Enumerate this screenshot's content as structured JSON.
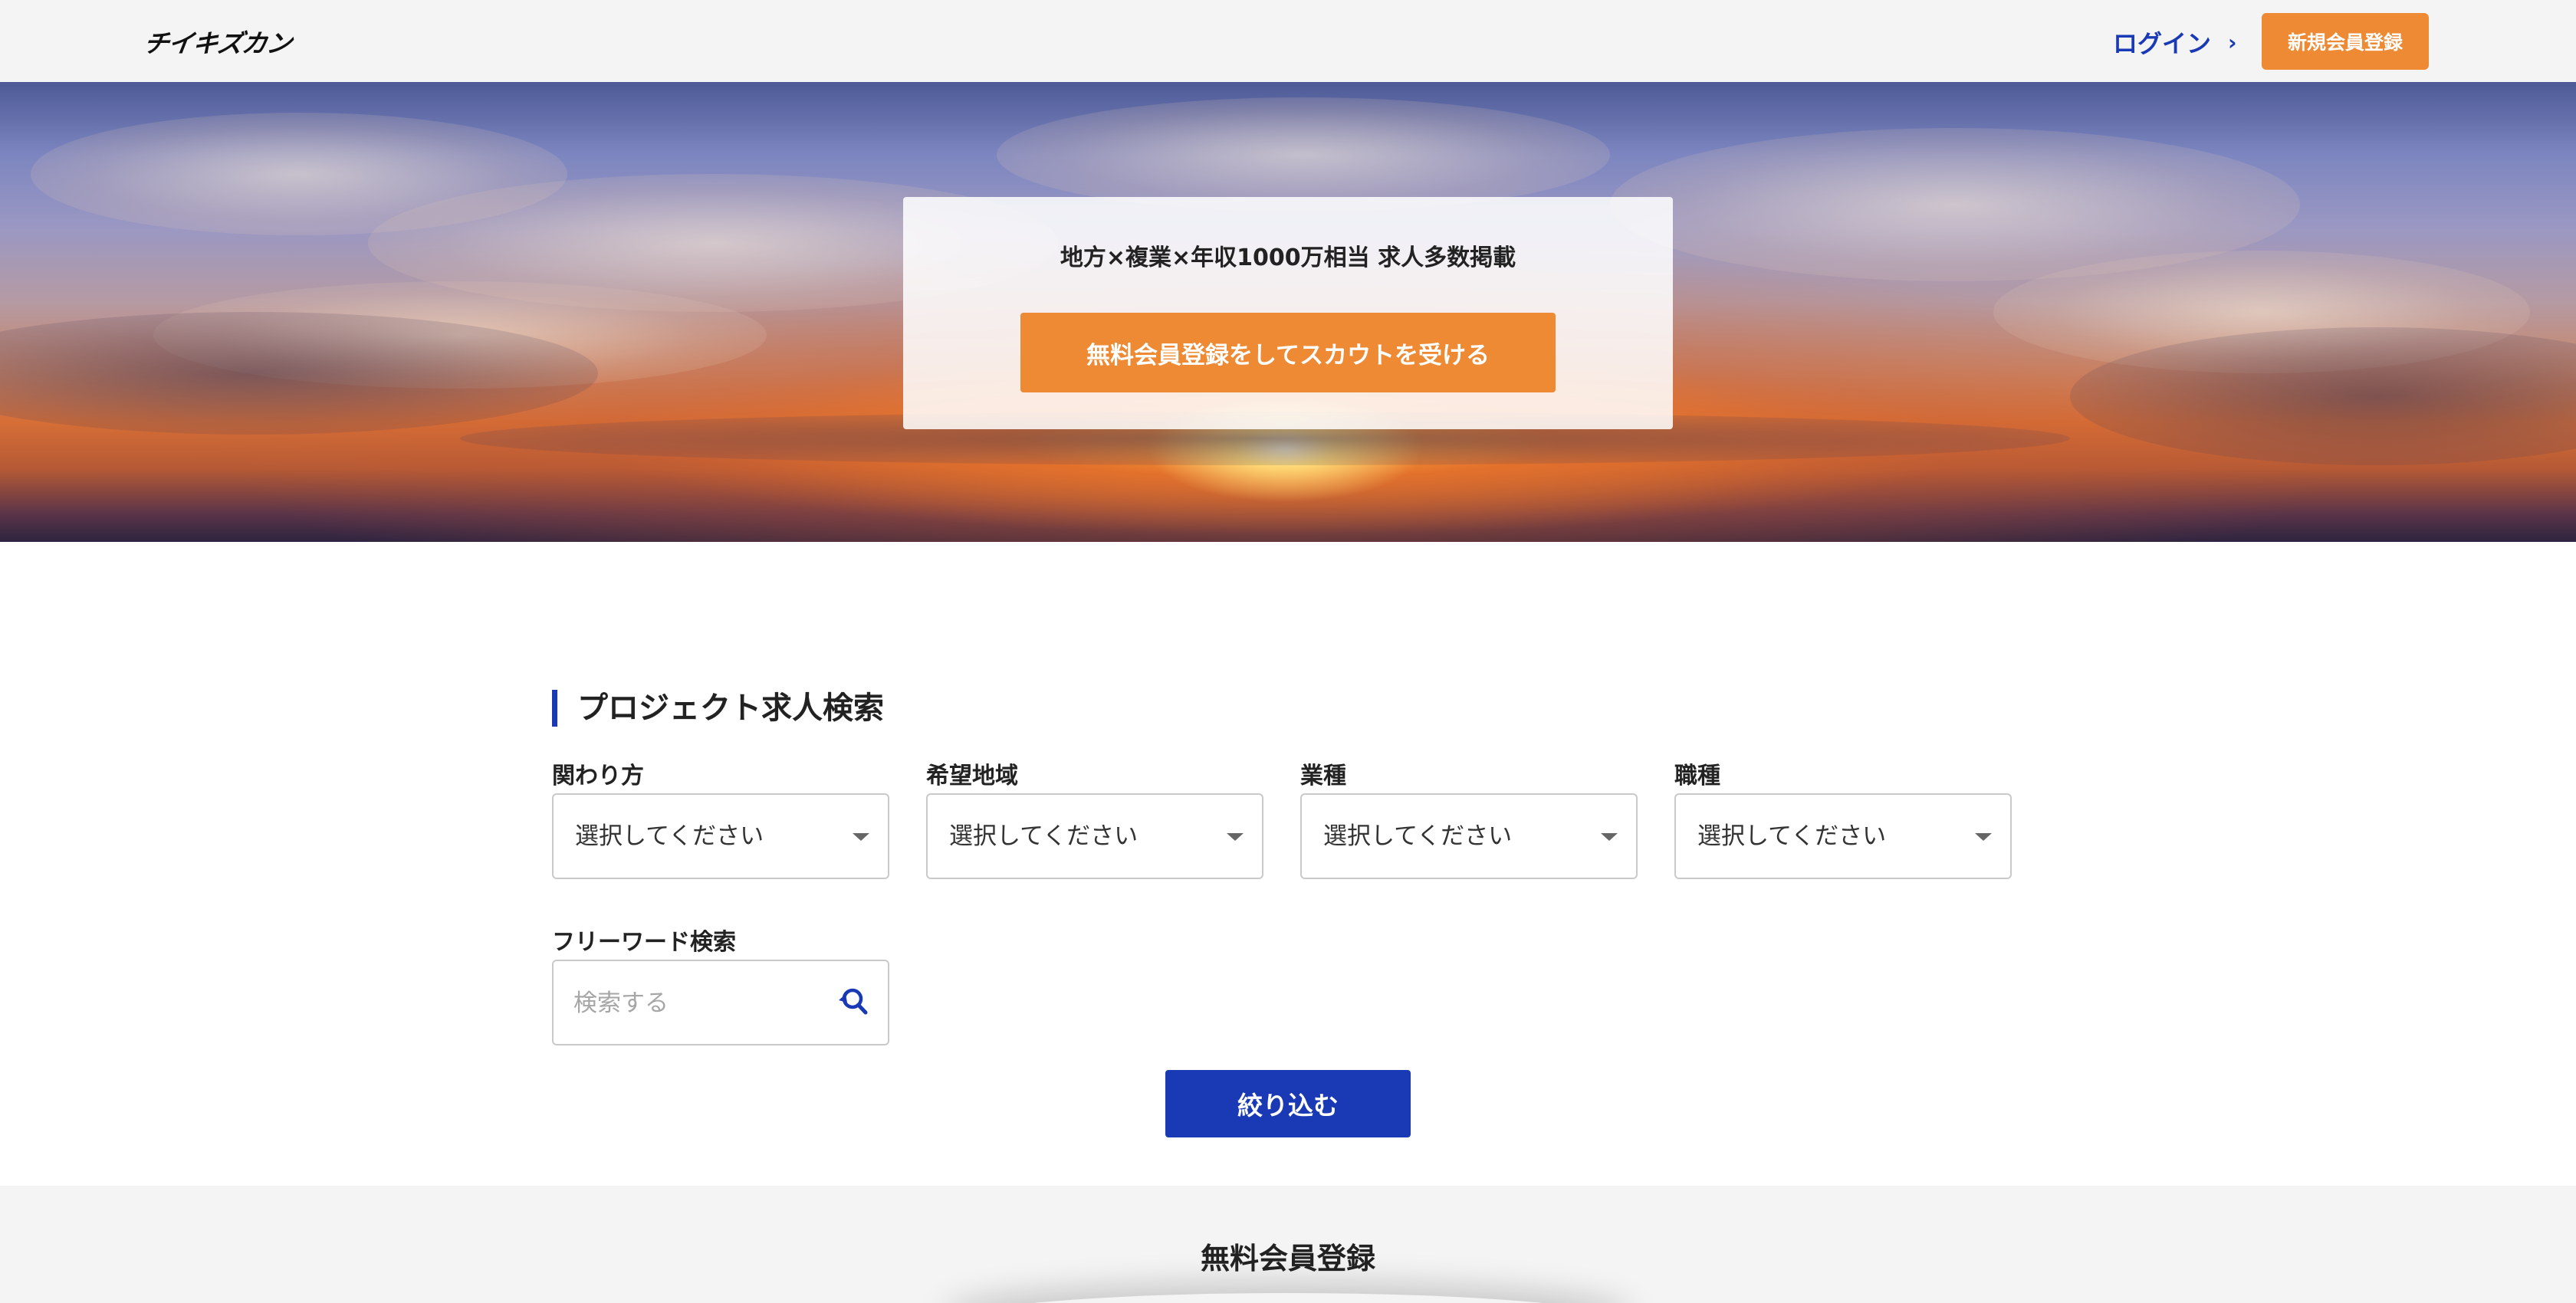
{
  "header": {
    "logo_text": "チイキズカン",
    "login_label": "ログイン",
    "login_chevron": "›",
    "register_label": "新規会員登録"
  },
  "hero": {
    "title": "地方×複業×年収1000万相当 求人多数掲載",
    "cta_label": "無料会員登録をしてスカウトを受ける"
  },
  "search": {
    "section_title": "プロジェクト求人検索",
    "fields": [
      {
        "label": "関わり方",
        "value": "選択してください"
      },
      {
        "label": "希望地域",
        "value": "選択してください"
      },
      {
        "label": "業種",
        "value": "選択してください"
      },
      {
        "label": "職種",
        "value": "選択してください"
      }
    ],
    "freeword_label": "フリーワード検索",
    "freeword_placeholder": "検索する",
    "filter_button_label": "絞り込む"
  },
  "bottom": {
    "title": "無料会員登録"
  },
  "colors": {
    "accent_orange": "#ef8a34",
    "accent_blue": "#1a3ab5",
    "header_bg": "#f4f4f4"
  },
  "icons": {
    "select_caret": "caret-down-icon",
    "search": "search-icon",
    "login": "chevron-right-icon"
  }
}
